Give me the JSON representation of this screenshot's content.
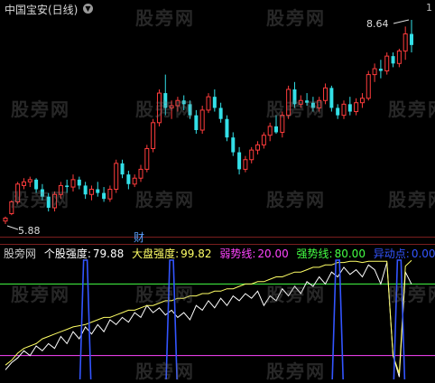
{
  "header": {
    "stock_title": "中国宝安(日线)",
    "dropdown_glyph": "▼",
    "corner_label": "1"
  },
  "watermark": "股旁网",
  "price_labels": {
    "high": "8.64",
    "low": "5.88"
  },
  "cai_badge": "财",
  "indicator": {
    "name": "股旁网",
    "fields": [
      {
        "label": "个股强度:",
        "value": "79.88",
        "color": "#ffffff"
      },
      {
        "label": "大盘强度:",
        "value": "99.82",
        "color": "#ffff66"
      },
      {
        "label": "弱势线:",
        "value": "20.00",
        "color": "#ff44ff"
      },
      {
        "label": "强势线:",
        "value": "80.00",
        "color": "#44ff44"
      },
      {
        "label": "异动点:",
        "value": "0.00",
        "color": "#3355ff"
      }
    ]
  },
  "colors": {
    "up": "#ff3c3c",
    "down": "#33e0e8",
    "grid": "#7a1e1e"
  },
  "chart_data": {
    "type": "candlestick",
    "title": "中国宝安(日线)",
    "price_range": [
      5.88,
      8.64
    ],
    "candles": [
      [
        5.92,
        5.98,
        5.88,
        5.96
      ],
      [
        6.02,
        6.2,
        6.0,
        6.18
      ],
      [
        6.18,
        6.45,
        6.15,
        6.42
      ],
      [
        6.4,
        6.5,
        6.35,
        6.45
      ],
      [
        6.45,
        6.52,
        6.38,
        6.48
      ],
      [
        6.48,
        6.5,
        6.3,
        6.35
      ],
      [
        6.35,
        6.42,
        6.2,
        6.25
      ],
      [
        6.25,
        6.3,
        6.05,
        6.1
      ],
      [
        6.1,
        6.32,
        6.05,
        6.28
      ],
      [
        6.28,
        6.45,
        6.22,
        6.4
      ],
      [
        6.4,
        6.48,
        6.3,
        6.38
      ],
      [
        6.38,
        6.55,
        6.32,
        6.48
      ],
      [
        6.48,
        6.52,
        6.35,
        6.4
      ],
      [
        6.4,
        6.45,
        6.22,
        6.28
      ],
      [
        6.28,
        6.4,
        6.2,
        6.35
      ],
      [
        6.35,
        6.45,
        6.25,
        6.3
      ],
      [
        6.3,
        6.38,
        6.18,
        6.22
      ],
      [
        6.22,
        6.4,
        6.18,
        6.35
      ],
      [
        6.35,
        6.75,
        6.3,
        6.7
      ],
      [
        6.7,
        6.75,
        6.5,
        6.55
      ],
      [
        6.55,
        6.6,
        6.35,
        6.42
      ],
      [
        6.42,
        6.55,
        6.38,
        6.5
      ],
      [
        6.5,
        6.68,
        6.45,
        6.62
      ],
      [
        6.62,
        6.95,
        6.58,
        6.9
      ],
      [
        6.9,
        7.3,
        6.85,
        7.25
      ],
      [
        7.25,
        7.7,
        7.2,
        7.65
      ],
      [
        7.65,
        7.9,
        7.35,
        7.45
      ],
      [
        7.45,
        7.55,
        7.3,
        7.48
      ],
      [
        7.48,
        7.6,
        7.4,
        7.55
      ],
      [
        7.55,
        7.62,
        7.42,
        7.5
      ],
      [
        7.5,
        7.55,
        7.3,
        7.35
      ],
      [
        7.35,
        7.42,
        7.1,
        7.15
      ],
      [
        7.15,
        7.48,
        7.1,
        7.42
      ],
      [
        7.42,
        7.65,
        7.38,
        7.6
      ],
      [
        7.6,
        7.7,
        7.4,
        7.45
      ],
      [
        7.45,
        7.52,
        7.25,
        7.3
      ],
      [
        7.3,
        7.35,
        7.0,
        7.05
      ],
      [
        7.05,
        7.12,
        6.8,
        6.85
      ],
      [
        6.85,
        6.92,
        6.55,
        6.62
      ],
      [
        6.62,
        6.8,
        6.58,
        6.75
      ],
      [
        6.75,
        6.92,
        6.7,
        6.88
      ],
      [
        6.88,
        7.0,
        6.82,
        6.95
      ],
      [
        6.95,
        7.12,
        6.9,
        7.08
      ],
      [
        7.08,
        7.25,
        7.0,
        7.2
      ],
      [
        7.2,
        7.35,
        7.1,
        7.12
      ],
      [
        7.12,
        7.4,
        7.05,
        7.35
      ],
      [
        7.35,
        7.75,
        7.3,
        7.7
      ],
      [
        7.7,
        7.8,
        7.45,
        7.5
      ],
      [
        7.5,
        7.62,
        7.45,
        7.55
      ],
      [
        7.55,
        7.65,
        7.48,
        7.52
      ],
      [
        7.52,
        7.6,
        7.4,
        7.45
      ],
      [
        7.45,
        7.6,
        7.4,
        7.55
      ],
      [
        7.55,
        7.78,
        7.5,
        7.72
      ],
      [
        7.72,
        7.75,
        7.4,
        7.45
      ],
      [
        7.45,
        7.5,
        7.3,
        7.35
      ],
      [
        7.35,
        7.55,
        7.3,
        7.5
      ],
      [
        7.5,
        7.6,
        7.35,
        7.4
      ],
      [
        7.4,
        7.58,
        7.35,
        7.52
      ],
      [
        7.52,
        7.65,
        7.45,
        7.58
      ],
      [
        7.58,
        7.95,
        7.55,
        7.9
      ],
      [
        7.9,
        8.05,
        7.8,
        7.98
      ],
      [
        7.98,
        8.1,
        7.85,
        7.95
      ],
      [
        7.95,
        8.2,
        7.9,
        8.15
      ],
      [
        8.15,
        8.2,
        8.0,
        8.05
      ],
      [
        8.05,
        8.25,
        8.0,
        8.22
      ],
      [
        8.22,
        8.55,
        8.1,
        8.45
      ],
      [
        8.45,
        8.64,
        8.2,
        8.3
      ]
    ],
    "indicator": {
      "series": [
        {
          "name": "个股强度",
          "color": "#ffffff",
          "values": [
            8,
            14,
            18,
            24,
            20,
            28,
            24,
            30,
            26,
            36,
            30,
            40,
            34,
            44,
            38,
            46,
            40,
            50,
            46,
            52,
            48,
            56,
            52,
            62,
            56,
            60,
            54,
            58,
            52,
            56,
            50,
            62,
            58,
            66,
            60,
            68,
            62,
            70,
            66,
            72,
            68,
            74,
            62,
            70,
            66,
            76,
            70,
            78,
            72,
            82,
            78,
            86,
            80,
            90,
            86,
            94,
            88,
            92,
            86,
            96,
            92,
            80,
            98,
            20,
            2,
            90,
            79.88
          ]
        },
        {
          "name": "大盘强度",
          "color": "#ffff66",
          "values": [
            12,
            16,
            22,
            26,
            28,
            30,
            34,
            36,
            38,
            40,
            42,
            44,
            45,
            46,
            48,
            50,
            52,
            52,
            54,
            56,
            58,
            58,
            60,
            62,
            62,
            64,
            66,
            66,
            68,
            68,
            70,
            70,
            72,
            72,
            74,
            74,
            76,
            76,
            78,
            80,
            80,
            82,
            82,
            84,
            86,
            86,
            88,
            90,
            90,
            92,
            94,
            94,
            96,
            96,
            98,
            98,
            99,
            99,
            98,
            99,
            99,
            99,
            99,
            20,
            5,
            95,
            99.82
          ]
        },
        {
          "name": "异动点",
          "color": "#3355ff",
          "values": [
            0,
            0,
            0,
            0,
            0,
            0,
            0,
            0,
            0,
            0,
            0,
            0,
            0,
            100,
            0,
            0,
            0,
            0,
            0,
            0,
            0,
            0,
            0,
            0,
            0,
            0,
            0,
            100,
            0,
            0,
            0,
            0,
            0,
            0,
            0,
            0,
            0,
            0,
            0,
            0,
            0,
            0,
            0,
            0,
            0,
            0,
            0,
            0,
            0,
            0,
            0,
            0,
            0,
            0,
            100,
            0,
            0,
            0,
            0,
            0,
            0,
            0,
            0,
            0,
            100,
            0,
            0
          ]
        }
      ],
      "levels": [
        {
          "name": "弱势线",
          "value": 20,
          "color": "#ff44ff"
        },
        {
          "name": "强势线",
          "value": 80,
          "color": "#44ff44"
        }
      ],
      "ylim": [
        0,
        100
      ]
    }
  }
}
